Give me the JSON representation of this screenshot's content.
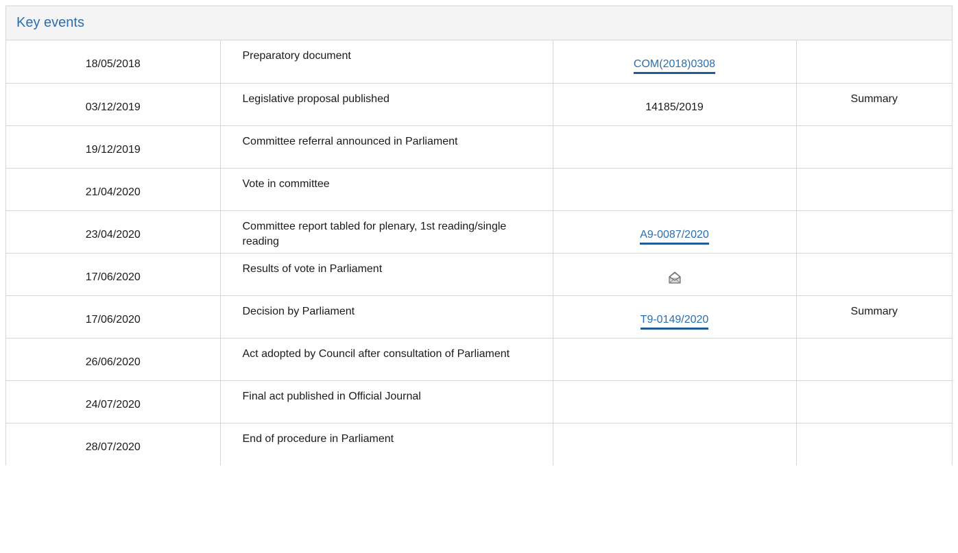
{
  "panel": {
    "title": "Key events"
  },
  "events": [
    {
      "date": "18/05/2018",
      "event": "Preparatory document",
      "doc": "COM(2018)0308",
      "doc_type": "link",
      "summary": ""
    },
    {
      "date": "03/12/2019",
      "event": "Legislative proposal published",
      "doc": "14185/2019",
      "doc_type": "text",
      "summary": "Summary"
    },
    {
      "date": "19/12/2019",
      "event": "Committee referral announced in Parliament",
      "doc": "",
      "doc_type": "none",
      "summary": ""
    },
    {
      "date": "21/04/2020",
      "event": "Vote in committee",
      "doc": "",
      "doc_type": "none",
      "summary": ""
    },
    {
      "date": "23/04/2020",
      "event": "Committee report tabled for plenary, 1st reading/single reading",
      "doc": "A9-0087/2020",
      "doc_type": "link",
      "summary": ""
    },
    {
      "date": "17/06/2020",
      "event": "Results of vote in Parliament",
      "doc": "",
      "doc_type": "icon",
      "icon": "envelope-icon",
      "summary": ""
    },
    {
      "date": "17/06/2020",
      "event": "Decision by Parliament",
      "doc": "T9-0149/2020",
      "doc_type": "link",
      "summary": "Summary"
    },
    {
      "date": "26/06/2020",
      "event": "Act adopted by Council after consultation of Parliament",
      "doc": "",
      "doc_type": "none",
      "summary": ""
    },
    {
      "date": "24/07/2020",
      "event": "Final act published in Official Journal",
      "doc": "",
      "doc_type": "none",
      "summary": ""
    },
    {
      "date": "28/07/2020",
      "event": "End of procedure in Parliament",
      "doc": "",
      "doc_type": "none",
      "summary": ""
    }
  ],
  "colors": {
    "title": "#2a6db0",
    "link": "#2a6db0",
    "link_underline": "#1f5a99",
    "border": "#d6d6d6",
    "header_bg": "#f4f4f4"
  }
}
